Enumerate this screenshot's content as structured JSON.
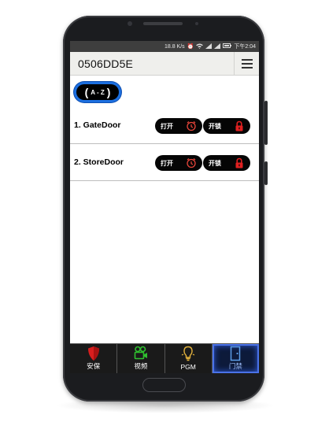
{
  "status_bar": {
    "speed": "18.8 K/s",
    "icons": [
      "alarm-icon",
      "wifi-icon",
      "signal-icon",
      "signal-icon",
      "battery-icon"
    ],
    "time": "下午2:04"
  },
  "header": {
    "title": "0506DD5E",
    "menu_icon": "hamburger-menu-icon"
  },
  "sort_button": {
    "label": "A - Z"
  },
  "doors": [
    {
      "name": "1. GateDoor",
      "open_label": "打开",
      "unlock_label": "开锁"
    },
    {
      "name": "2. StoreDoor",
      "open_label": "打开",
      "unlock_label": "开锁"
    }
  ],
  "tabs": [
    {
      "label": "安保",
      "icon": "shield-icon",
      "active": false
    },
    {
      "label": "视频",
      "icon": "video-camera-icon",
      "active": false
    },
    {
      "label": "PGM",
      "icon": "bulb-icon",
      "active": false
    },
    {
      "label": "门禁",
      "icon": "door-icon",
      "active": true
    }
  ],
  "colors": {
    "accent_blue": "#1c6fe0",
    "lock_red": "#e02020",
    "clock_red": "#e8453a",
    "shield_red": "#d81e1e",
    "video_green": "#2fc02f",
    "bulb_yellow": "#e3b23c",
    "door_blue": "#5d9ee8"
  }
}
